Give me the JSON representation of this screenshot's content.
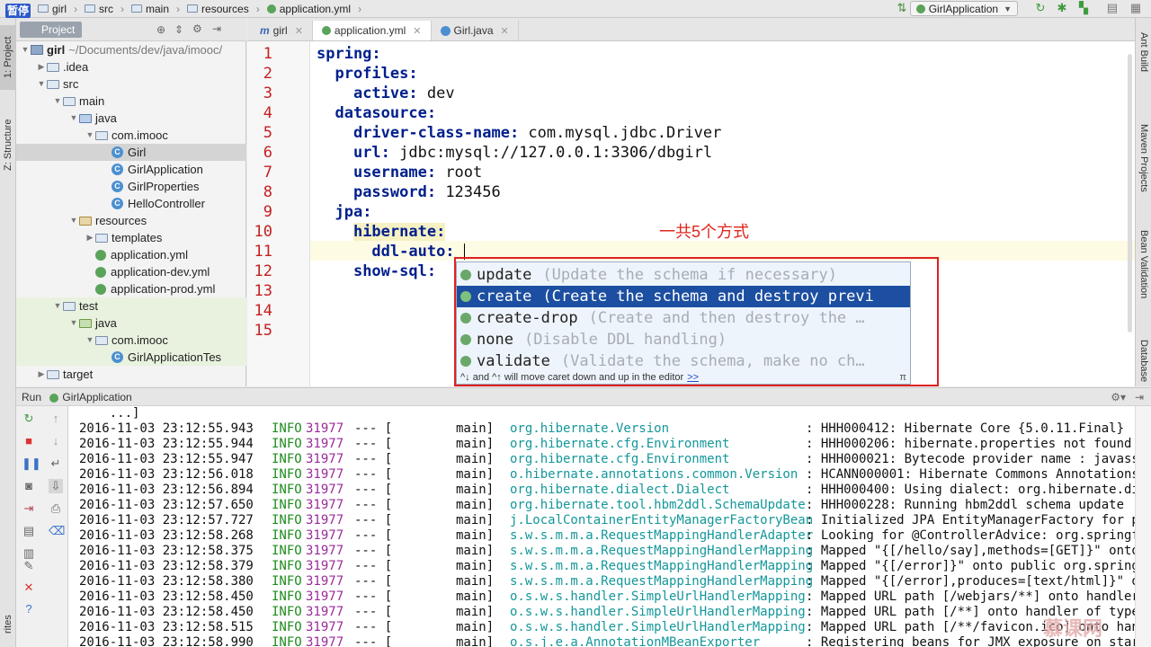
{
  "navbar": {
    "pause_badge": "暂停",
    "crumbs": [
      "girl",
      "src",
      "main",
      "resources",
      "application.yml"
    ],
    "run_config": "GirlApplication"
  },
  "left_strip": {
    "project": "1: Project",
    "structure": "Z: Structure",
    "favorites": "rites"
  },
  "right_strip": {
    "ant": "Ant Build",
    "maven": "Maven Projects",
    "bean": "Bean Validation",
    "database": "Database"
  },
  "project_panel": {
    "title": "Project",
    "tree": [
      {
        "label": "girl",
        "path": "~/Documents/dev/java/imooc/",
        "level": 0,
        "arrow": "open",
        "icon": "module"
      },
      {
        "label": ".idea",
        "level": 1,
        "arrow": "closed",
        "icon": "folder"
      },
      {
        "label": "src",
        "level": 1,
        "arrow": "open",
        "icon": "folder"
      },
      {
        "label": "main",
        "level": 2,
        "arrow": "open",
        "icon": "folder"
      },
      {
        "label": "java",
        "level": 3,
        "arrow": "open",
        "icon": "src-folder"
      },
      {
        "label": "com.imooc",
        "level": 4,
        "arrow": "open",
        "icon": "folder"
      },
      {
        "label": "Girl",
        "level": 5,
        "arrow": "none",
        "icon": "class",
        "selected": true
      },
      {
        "label": "GirlApplication",
        "level": 5,
        "arrow": "none",
        "icon": "class"
      },
      {
        "label": "GirlProperties",
        "level": 5,
        "arrow": "none",
        "icon": "class"
      },
      {
        "label": "HelloController",
        "level": 5,
        "arrow": "none",
        "icon": "class"
      },
      {
        "label": "resources",
        "level": 3,
        "arrow": "open",
        "icon": "res-folder"
      },
      {
        "label": "templates",
        "level": 4,
        "arrow": "closed",
        "icon": "folder"
      },
      {
        "label": "application.yml",
        "level": 4,
        "arrow": "none",
        "icon": "yml"
      },
      {
        "label": "application-dev.yml",
        "level": 4,
        "arrow": "none",
        "icon": "yml"
      },
      {
        "label": "application-prod.yml",
        "level": 4,
        "arrow": "none",
        "icon": "yml"
      },
      {
        "label": "test",
        "level": 2,
        "arrow": "open",
        "icon": "folder",
        "test": true
      },
      {
        "label": "java",
        "level": 3,
        "arrow": "open",
        "icon": "test-folder",
        "test": true
      },
      {
        "label": "com.imooc",
        "level": 4,
        "arrow": "open",
        "icon": "folder",
        "test": true
      },
      {
        "label": "GirlApplicationTes",
        "level": 5,
        "arrow": "none",
        "icon": "class",
        "test": true
      },
      {
        "label": "target",
        "level": 1,
        "arrow": "closed",
        "icon": "folder"
      }
    ]
  },
  "editor": {
    "tabs": [
      {
        "label": "girl",
        "kind": "maven"
      },
      {
        "label": "application.yml",
        "kind": "yml",
        "active": true
      },
      {
        "label": "Girl.java",
        "kind": "class"
      }
    ],
    "lines": [
      {
        "n": "1",
        "indent": "",
        "key": "spring:",
        "value": ""
      },
      {
        "n": "2",
        "indent": "  ",
        "key": "profiles:",
        "value": ""
      },
      {
        "n": "3",
        "indent": "    ",
        "key": "active:",
        "value": " dev"
      },
      {
        "n": "4",
        "indent": "  ",
        "key": "datasource:",
        "value": ""
      },
      {
        "n": "5",
        "indent": "    ",
        "key": "driver-class-name:",
        "value": " com.mysql.jdbc.Driver"
      },
      {
        "n": "6",
        "indent": "    ",
        "key": "url:",
        "value": " jdbc:mysql://127.0.0.1:3306/dbgirl"
      },
      {
        "n": "7",
        "indent": "    ",
        "key": "username:",
        "value": " root"
      },
      {
        "n": "8",
        "indent": "    ",
        "key": "password:",
        "value": " 123456"
      },
      {
        "n": "9",
        "indent": "  ",
        "key": "jpa:",
        "value": ""
      },
      {
        "n": "10",
        "indent": "    ",
        "key": "hibernate:",
        "value": "",
        "highlight": true
      },
      {
        "n": "11",
        "indent": "      ",
        "key": "ddl-auto:",
        "value": " ",
        "caret": true
      },
      {
        "n": "12",
        "indent": "    ",
        "key": "show-sql:",
        "value": ""
      },
      {
        "n": "13",
        "indent": "",
        "key": "",
        "value": ""
      },
      {
        "n": "14",
        "indent": "",
        "key": "",
        "value": ""
      },
      {
        "n": "15",
        "indent": "",
        "key": "",
        "value": ""
      }
    ],
    "annotation": "一共5个方式"
  },
  "completion": {
    "items": [
      {
        "name": "update",
        "hint": "(Update the schema if necessary)"
      },
      {
        "name": "create",
        "hint": "(Create the schema and destroy previ",
        "selected": true
      },
      {
        "name": "create-drop",
        "hint": "(Create and then destroy the …"
      },
      {
        "name": "none",
        "hint": "(Disable DDL handling)"
      },
      {
        "name": "validate",
        "hint": "(Validate the schema, make no ch…"
      }
    ],
    "footer": "^↓ and ^↑ will move caret down and up in the editor",
    "footer_link": ">>",
    "pi": "π"
  },
  "run_panel": {
    "title": "Run",
    "config": "GirlApplication",
    "first_line": "    ...]",
    "logs": [
      {
        "ts": "2016-11-03 23:12:55.943",
        "level": "INFO",
        "pid": "31977",
        "thread": "main]",
        "logger": "org.hibernate.Version",
        "msg": ": HHH000412: Hibernate Core {5.0.11.Final}"
      },
      {
        "ts": "2016-11-03 23:12:55.944",
        "level": "INFO",
        "pid": "31977",
        "thread": "main]",
        "logger": "org.hibernate.cfg.Environment",
        "msg": ": HHH000206: hibernate.properties not found"
      },
      {
        "ts": "2016-11-03 23:12:55.947",
        "level": "INFO",
        "pid": "31977",
        "thread": "main]",
        "logger": "org.hibernate.cfg.Environment",
        "msg": ": HHH000021: Bytecode provider name : javassist"
      },
      {
        "ts": "2016-11-03 23:12:56.018",
        "level": "INFO",
        "pid": "31977",
        "thread": "main]",
        "logger": "o.hibernate.annotations.common.Version",
        "msg": ": HCANN000001: Hibernate Commons Annotations {5"
      },
      {
        "ts": "2016-11-03 23:12:56.894",
        "level": "INFO",
        "pid": "31977",
        "thread": "main]",
        "logger": "org.hibernate.dialect.Dialect",
        "msg": ": HHH000400: Using dialect: org.hibernate.diale"
      },
      {
        "ts": "2016-11-03 23:12:57.650",
        "level": "INFO",
        "pid": "31977",
        "thread": "main]",
        "logger": "org.hibernate.tool.hbm2ddl.SchemaUpdate",
        "msg": ": HHH000228: Running hbm2ddl schema update"
      },
      {
        "ts": "2016-11-03 23:12:57.727",
        "level": "INFO",
        "pid": "31977",
        "thread": "main]",
        "logger": "j.LocalContainerEntityManagerFactoryBean",
        "msg": ": Initialized JPA EntityManagerFactory for pers"
      },
      {
        "ts": "2016-11-03 23:12:58.268",
        "level": "INFO",
        "pid": "31977",
        "thread": "main]",
        "logger": "s.w.s.m.m.a.RequestMappingHandlerAdapter",
        "msg": ": Looking for @ControllerAdvice: org.springfram"
      },
      {
        "ts": "2016-11-03 23:12:58.375",
        "level": "INFO",
        "pid": "31977",
        "thread": "main]",
        "logger": "s.w.s.m.m.a.RequestMappingHandlerMapping",
        "msg": ": Mapped \"{[/hello/say],methods=[GET]}\" onto pu"
      },
      {
        "ts": "2016-11-03 23:12:58.379",
        "level": "INFO",
        "pid": "31977",
        "thread": "main]",
        "logger": "s.w.s.m.m.a.RequestMappingHandlerMapping",
        "msg": ": Mapped \"{[/error]}\" onto public org.springfra"
      },
      {
        "ts": "2016-11-03 23:12:58.380",
        "level": "INFO",
        "pid": "31977",
        "thread": "main]",
        "logger": "s.w.s.m.m.a.RequestMappingHandlerMapping",
        "msg": ": Mapped \"{[/error],produces=[text/html]}\" onto"
      },
      {
        "ts": "2016-11-03 23:12:58.450",
        "level": "INFO",
        "pid": "31977",
        "thread": "main]",
        "logger": "o.s.w.s.handler.SimpleUrlHandlerMapping",
        "msg": ": Mapped URL path [/webjars/**] onto handler of"
      },
      {
        "ts": "2016-11-03 23:12:58.450",
        "level": "INFO",
        "pid": "31977",
        "thread": "main]",
        "logger": "o.s.w.s.handler.SimpleUrlHandlerMapping",
        "msg": ": Mapped URL path [/**] onto handler of type [c"
      },
      {
        "ts": "2016-11-03 23:12:58.515",
        "level": "INFO",
        "pid": "31977",
        "thread": "main]",
        "logger": "o.s.w.s.handler.SimpleUrlHandlerMapping",
        "msg": ": Mapped URL path [/**/favicon.ico] onto handle"
      },
      {
        "ts": "2016-11-03 23:12:58.990",
        "level": "INFO",
        "pid": "31977",
        "thread": "main]",
        "logger": "o.s.j.e.a.AnnotationMBeanExporter",
        "msg": ": Registering beans for JMX exposure on startup"
      }
    ]
  },
  "watermark": "慕课网",
  "colors": {
    "accent_selection": "#1c4fa1",
    "annotation_red": "#e0261d",
    "info_green": "#1d8c1d",
    "logger_teal": "#14979a",
    "pid_purple": "#9a2b9a"
  }
}
